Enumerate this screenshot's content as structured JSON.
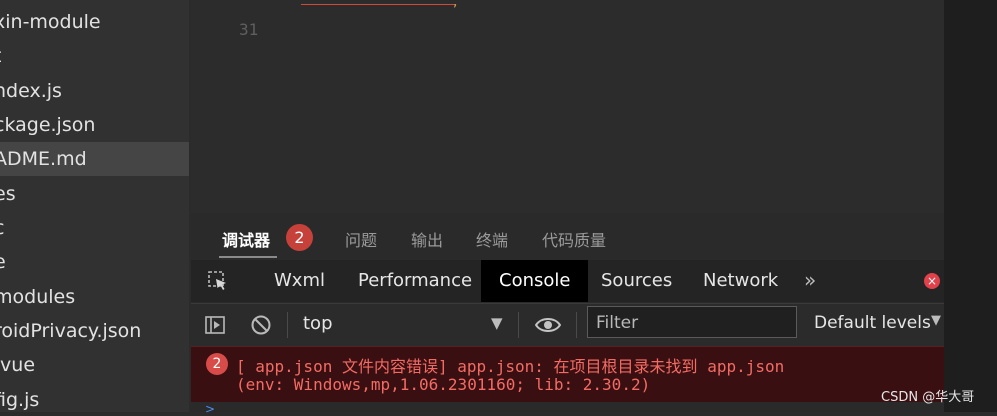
{
  "sidebar": {
    "items": [
      {
        "label": "xin-module"
      },
      {
        "label": "t"
      },
      {
        "label": "ndex.js"
      },
      {
        "label": "ckage.json"
      },
      {
        "label": "ADME.md"
      },
      {
        "label": "es"
      },
      {
        "label": "c"
      },
      {
        "label": "e"
      },
      {
        "label": "modules"
      },
      {
        "label": "roidPrivacy.json"
      },
      {
        "label": ".vue"
      },
      {
        "label": "fig.js"
      }
    ],
    "selected_index": 4
  },
  "editor": {
    "line_number": "31",
    "snippet_end": ","
  },
  "panel": {
    "tabs": [
      {
        "label": "调试器",
        "active": true
      },
      {
        "label": "问题"
      },
      {
        "label": "输出"
      },
      {
        "label": "终端"
      },
      {
        "label": "代码质量"
      }
    ],
    "debugger_badge": "2"
  },
  "devtools": {
    "tabs": [
      {
        "label": "Wxml"
      },
      {
        "label": "Performance"
      },
      {
        "label": "Console",
        "active": true
      },
      {
        "label": "Sources"
      },
      {
        "label": "Network"
      }
    ],
    "more": "»",
    "close_glyph": "×"
  },
  "console_toolbar": {
    "context": "top",
    "context_arrow": "▼",
    "filter_placeholder": "Filter",
    "levels": "Default levels",
    "levels_arrow": "▼"
  },
  "error": {
    "count": "2",
    "line1": "[ app.json 文件内容错误] app.json: 在项目根目录未找到 app.json",
    "line2": "(env: Windows,mp,1.06.2301160; lib: 2.30.2)"
  },
  "prompt_glyph": ">",
  "watermark": "CSDN @华大哥",
  "colors": {
    "error_text": "#f36b63",
    "error_bg": "#3a0f12",
    "badge_red": "#c7413b",
    "active_tab_bg": "#000000"
  }
}
